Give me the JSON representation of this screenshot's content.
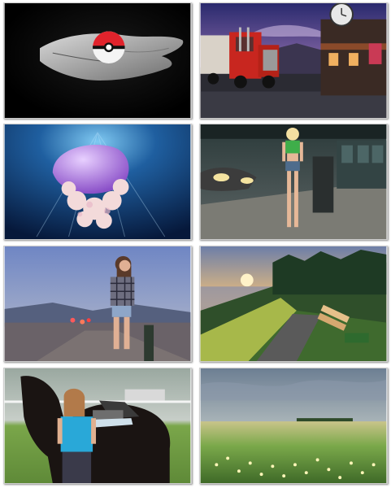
{
  "gallery": {
    "thumbnails": [
      {
        "subject": "hand-holding-pokeball",
        "accent": "#e0232c"
      },
      {
        "subject": "red-truck-at-dusk-diner",
        "accent": "#c8261f"
      },
      {
        "subject": "jellyfish-underwater",
        "accent": "#b58be0"
      },
      {
        "subject": "woman-green-top-garage",
        "accent": "#3fae4a"
      },
      {
        "subject": "woman-plaid-shirt-road",
        "accent": "#7a8fb8"
      },
      {
        "subject": "coastal-sunset-bench",
        "accent": "#f2a540"
      },
      {
        "subject": "woman-with-black-horse",
        "accent": "#29a8d8"
      },
      {
        "subject": "meadow-wildflowers",
        "accent": "#7aa84a"
      }
    ]
  }
}
